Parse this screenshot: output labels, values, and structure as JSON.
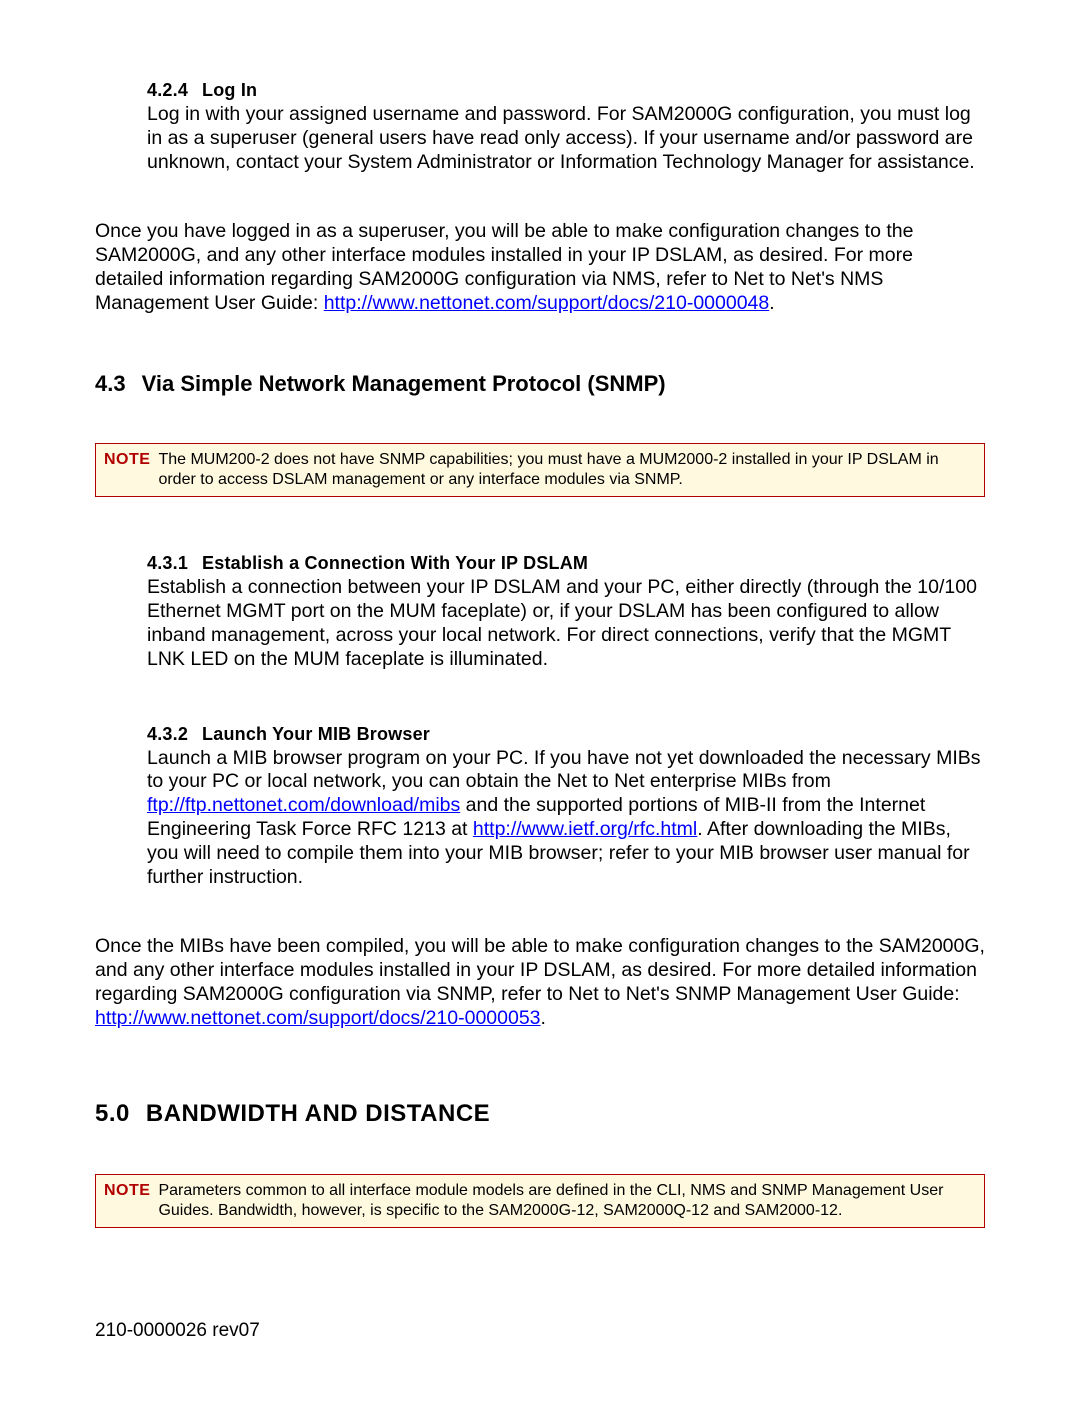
{
  "sec424": {
    "num": "4.2.4",
    "title": "Log In",
    "p1": "Log in with your assigned username and password. For SAM2000G configuration, you must log in as a superuser (general users have read only access). If your username and/or password are unknown, contact your System Administrator or Information Technology Manager for assistance.",
    "p2a": "Once you have logged in as a superuser, you will be able to make configuration changes to the SAM2000G, and any other interface modules installed in your IP DSLAM, as desired. For more detailed information regarding SAM2000G configuration via NMS, refer to Net to Net's NMS Management User Guide: ",
    "link": "http://www.nettonet.com/support/docs/210-0000048",
    "period": "."
  },
  "sec43": {
    "num": "4.3",
    "title": "Via Simple Network Management Protocol (SNMP)"
  },
  "note1": {
    "label": "NOTE",
    "text": "The MUM200-2 does not have SNMP capabilities; you must have a MUM2000-2 installed in your IP DSLAM in order to access DSLAM management or any interface modules via SNMP."
  },
  "sec431": {
    "num": "4.3.1",
    "title": "Establish a Connection With Your IP DSLAM",
    "p1": "Establish a connection between your IP DSLAM and your PC, either directly (through the 10/100 Ethernet MGMT port on the MUM faceplate) or, if your DSLAM has been configured to allow inband management, across your local network. For direct connections, verify that the MGMT LNK LED on the MUM faceplate is illuminated."
  },
  "sec432": {
    "num": "4.3.2",
    "title": "Launch Your MIB Browser",
    "p1a": "Launch a MIB browser program on your PC. If you have not yet downloaded the necessary MIBs to your PC or local network, you can obtain the Net to Net enterprise MIBs from ",
    "link1": "ftp://ftp.nettonet.com/download/mibs",
    "p1b": " and the supported portions of MIB-II from the Internet Engineering Task Force RFC 1213 at ",
    "link2": "http://www.ietf.org/rfc.html",
    "p1c": ". After downloading the MIBs, you will need to compile them into your MIB browser; refer to your MIB browser user manual for further instruction.",
    "p2a": "Once the MIBs have been compiled, you will be able to make configuration changes to the SAM2000G, and any other interface modules installed in your IP DSLAM, as desired. For more detailed information regarding SAM2000G configuration via SNMP, refer to Net to Net's SNMP Management User Guide: ",
    "link3": "http://www.nettonet.com/support/docs/210-0000053",
    "period": "."
  },
  "sec50": {
    "num": "5.0",
    "title": "BANDWIDTH AND DISTANCE"
  },
  "note2": {
    "label": "NOTE",
    "text": "Parameters common to all interface module models are defined in the CLI, NMS and SNMP Management User Guides. Bandwidth, however, is specific to the SAM2000G-12, SAM2000Q-12 and SAM2000-12."
  },
  "footer": "210-0000026 rev07"
}
